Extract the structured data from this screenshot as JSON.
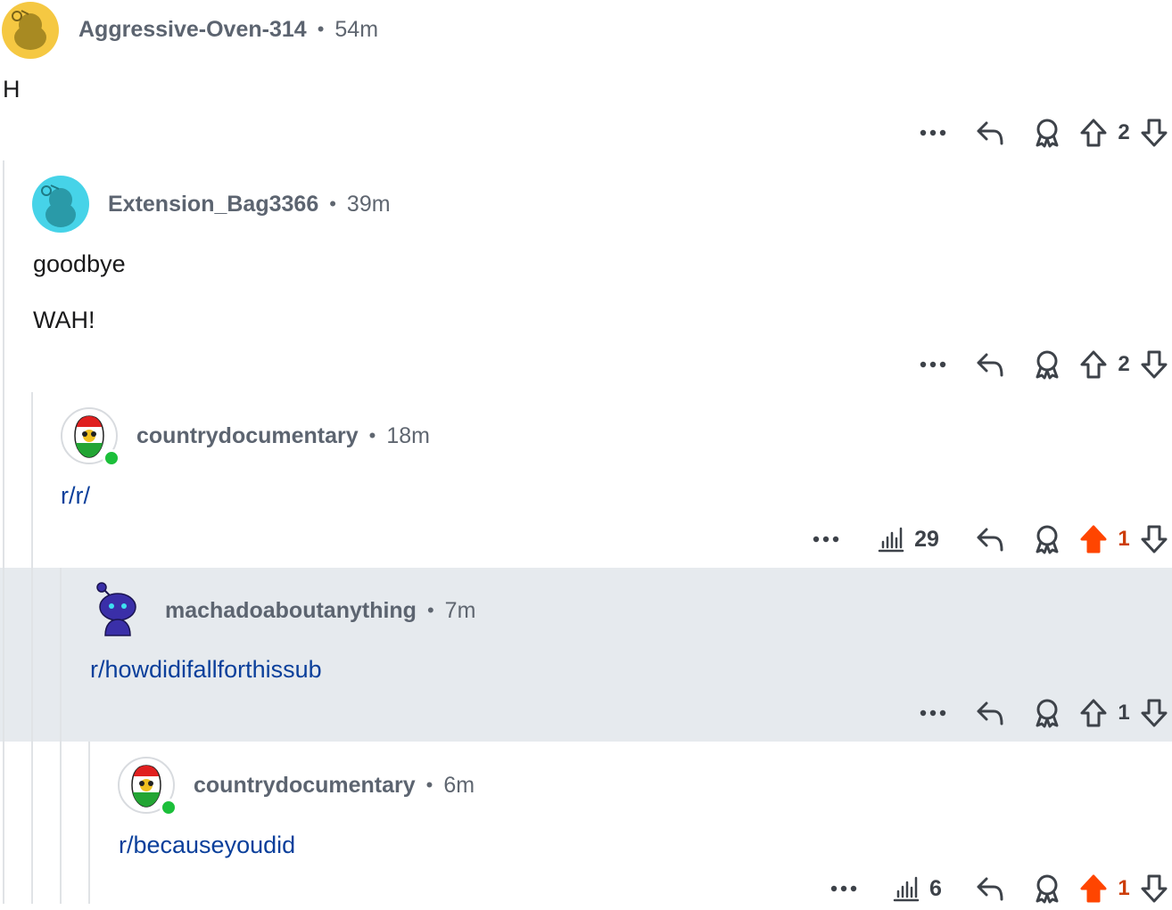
{
  "colors": {
    "accent_upvote": "#ff4500",
    "link": "#0a3f9b",
    "online": "#1cbf3a",
    "highlight_bg": "#e6eaee"
  },
  "comments": [
    {
      "user": "Aggressive-Oven-314",
      "sep": "•",
      "time": "54m",
      "lines": [
        "H"
      ],
      "score": "2",
      "upvoted": false
    },
    {
      "user": "Extension_Bag3366",
      "sep": "•",
      "time": "39m",
      "lines": [
        "goodbye",
        "WAH!"
      ],
      "score": "2",
      "upvoted": false
    },
    {
      "user": "countrydocumentary",
      "sep": "•",
      "time": "18m",
      "lines": [
        "r/r/"
      ],
      "views": "29",
      "score": "1",
      "upvoted": true
    },
    {
      "user": "machadoaboutanything",
      "sep": "•",
      "time": "7m",
      "lines": [
        "r/howdidifallforthissub"
      ],
      "score": "1",
      "upvoted": false
    },
    {
      "user": "countrydocumentary",
      "sep": "•",
      "time": "6m",
      "lines": [
        "r/becauseyoudid"
      ],
      "views": "6",
      "score": "1",
      "upvoted": true
    }
  ],
  "icons": {
    "more": "more-dots-icon",
    "reply": "reply-arrow-icon",
    "award": "award-ribbon-icon",
    "upvote": "upvote-arrow-icon",
    "downvote": "downvote-arrow-icon",
    "views": "bar-chart-icon"
  }
}
